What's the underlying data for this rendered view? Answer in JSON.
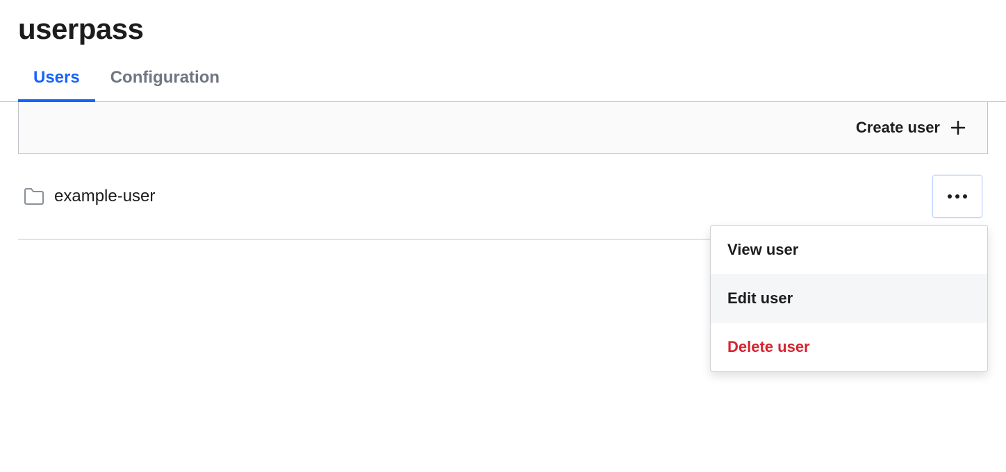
{
  "header": {
    "title": "userpass"
  },
  "tabs": {
    "users": {
      "label": "Users",
      "active": true
    },
    "configuration": {
      "label": "Configuration",
      "active": false
    }
  },
  "toolbar": {
    "create_user_label": "Create user"
  },
  "users": [
    {
      "name": "example-user"
    }
  ],
  "dropdown": {
    "view_user_label": "View user",
    "edit_user_label": "Edit user",
    "delete_user_label": "Delete user"
  },
  "colors": {
    "accent": "#1563ff",
    "text": "#1c1c1e",
    "muted": "#6f7682",
    "border": "#c2c2c8",
    "danger": "#d6232f",
    "toolbar_bg": "#fafafb",
    "hover_bg": "#f5f6f8"
  }
}
